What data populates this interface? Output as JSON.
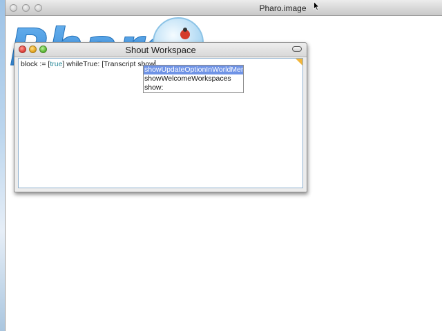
{
  "host_window": {
    "title": "Pharo.image"
  },
  "logo": {
    "text": "Pharo"
  },
  "workspace": {
    "title": "Shout Workspace",
    "code": {
      "before_kw": "block := [",
      "keyword": "true",
      "after_kw": "] whileTrue: [Transcript show"
    }
  },
  "completion": {
    "items": [
      {
        "label": "showUpdateOptionInWorldMenu",
        "selected": true
      },
      {
        "label": "showWelcomeWorkspaces",
        "selected": false
      },
      {
        "label": "show:",
        "selected": false
      }
    ]
  },
  "icons": {
    "close": "close-icon",
    "minimize": "minimize-icon",
    "maximize": "maximize-icon",
    "collapse": "collapse-icon",
    "cursor": "mouse-pointer-icon"
  },
  "colors": {
    "keyword": "#2a8a9a",
    "selection": "#6f93e6",
    "logo_blue": "#3a8fd8"
  }
}
